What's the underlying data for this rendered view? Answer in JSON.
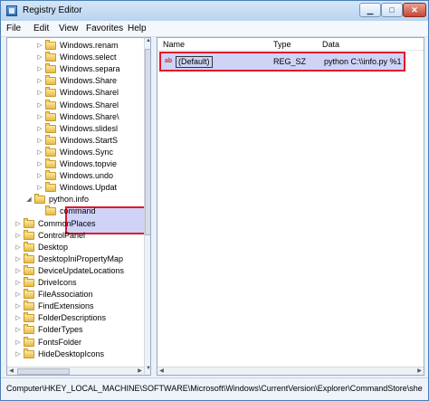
{
  "window": {
    "title": "Registry Editor"
  },
  "menu": [
    "File",
    "Edit",
    "View",
    "Favorites",
    "Help"
  ],
  "tree": {
    "rows": [
      {
        "label": "Windows.renam",
        "indent": 3,
        "expander": "▷"
      },
      {
        "label": "Windows.select",
        "indent": 3,
        "expander": "▷"
      },
      {
        "label": "Windows.separa",
        "indent": 3,
        "expander": "▷"
      },
      {
        "label": "Windows.Share",
        "indent": 3,
        "expander": "▷"
      },
      {
        "label": "Windows.Sharel",
        "indent": 3,
        "expander": "▷"
      },
      {
        "label": "Windows.Sharel",
        "indent": 3,
        "expander": "▷"
      },
      {
        "label": "Windows.Share\\",
        "indent": 3,
        "expander": "▷"
      },
      {
        "label": "Windows.slidesl",
        "indent": 3,
        "expander": "▷"
      },
      {
        "label": "Windows.StartS",
        "indent": 3,
        "expander": "▷"
      },
      {
        "label": "Windows.Sync",
        "indent": 3,
        "expander": "▷"
      },
      {
        "label": "Windows.topvie",
        "indent": 3,
        "expander": "▷"
      },
      {
        "label": "Windows.undo",
        "indent": 3,
        "expander": "▷"
      },
      {
        "label": "Windows.Updat",
        "indent": 3,
        "expander": "▷"
      },
      {
        "label": "python.info",
        "indent": 2,
        "expander": "◢"
      },
      {
        "label": "command",
        "indent": 3,
        "expander": ""
      },
      {
        "label": "CommonPlaces",
        "indent": 1,
        "expander": "▷"
      },
      {
        "label": "ControlPanel",
        "indent": 1,
        "expander": "▷"
      },
      {
        "label": "Desktop",
        "indent": 1,
        "expander": "▷"
      },
      {
        "label": "DesktopIniPropertyMap",
        "indent": 1,
        "expander": "▷"
      },
      {
        "label": "DeviceUpdateLocations",
        "indent": 1,
        "expander": "▷"
      },
      {
        "label": "DriveIcons",
        "indent": 1,
        "expander": "▷"
      },
      {
        "label": "FileAssociation",
        "indent": 1,
        "expander": "▷"
      },
      {
        "label": "FindExtensions",
        "indent": 1,
        "expander": "▷"
      },
      {
        "label": "FolderDescriptions",
        "indent": 1,
        "expander": "▷"
      },
      {
        "label": "FolderTypes",
        "indent": 1,
        "expander": "▷"
      },
      {
        "label": "FontsFolder",
        "indent": 1,
        "expander": "▷"
      },
      {
        "label": "HideDesktopIcons",
        "indent": 1,
        "expander": "▷"
      }
    ]
  },
  "values": {
    "columns": [
      "Name",
      "Type",
      "Data"
    ],
    "rows": [
      {
        "icon": "ab",
        "name": "(Default)",
        "type": "REG_SZ",
        "data": "python C:\\\\info.py %1"
      }
    ]
  },
  "status": {
    "path": "Computer\\HKEY_LOCAL_MACHINE\\SOFTWARE\\Microsoft\\Windows\\CurrentVersion\\Explorer\\CommandStore\\she"
  }
}
